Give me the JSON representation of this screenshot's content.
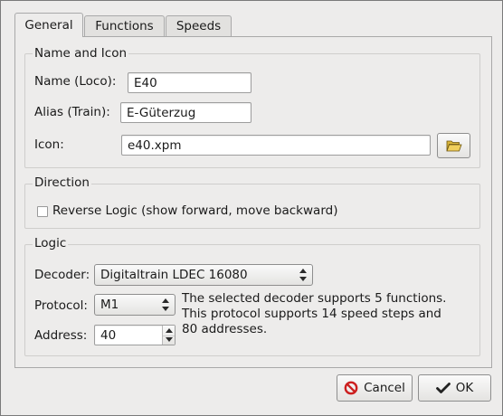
{
  "tabs": [
    {
      "label": "General",
      "active": true
    },
    {
      "label": "Functions",
      "active": false
    },
    {
      "label": "Speeds",
      "active": false
    }
  ],
  "name_icon": {
    "title": "Name and Icon",
    "name_label": "Name (Loco):",
    "name_value": "E40",
    "alias_label": "Alias (Train):",
    "alias_value": "E-Güterzug",
    "icon_label": "Icon:",
    "icon_value": "e40.xpm",
    "browse_icon": "folder-open-icon"
  },
  "direction": {
    "title": "Direction",
    "reverse_label": "Reverse Logic (show forward, move backward)",
    "reverse_checked": false
  },
  "logic": {
    "title": "Logic",
    "decoder_label": "Decoder:",
    "decoder_value": "Digitaltrain LDEC 16080",
    "protocol_label": "Protocol:",
    "protocol_value": "M1",
    "address_label": "Address:",
    "address_value": "40",
    "info_line1": "The selected decoder supports 5 functions.",
    "info_line2": "This protocol supports 14 speed steps and",
    "info_line3": "80 addresses."
  },
  "buttons": {
    "cancel_label": "Cancel",
    "ok_label": "OK"
  },
  "colors": {
    "cancel_icon": "#cc1f1f",
    "ok_icon": "#222222",
    "folder_icon": "#c9a227"
  }
}
